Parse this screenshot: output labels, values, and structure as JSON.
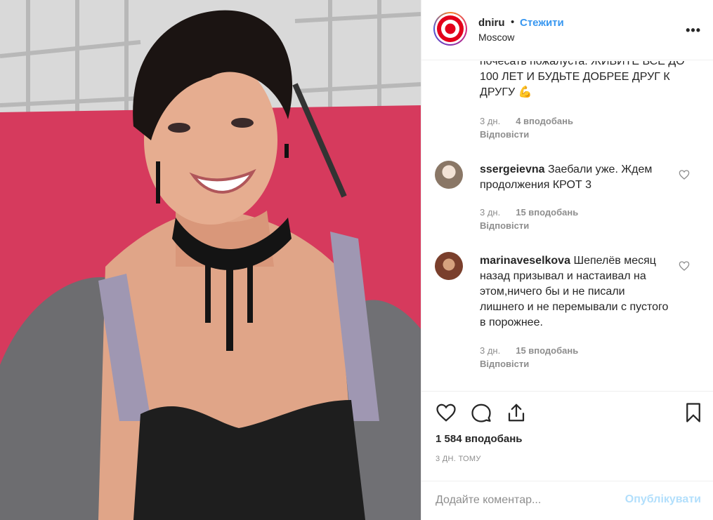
{
  "post": {
    "username": "dniru",
    "separator": "•",
    "follow_label": "Стежити",
    "location": "Moscow",
    "more_label": "•••"
  },
  "comments": [
    {
      "text": "почесать пожалуста. ЖИВИТЕ ВСЕ ДО 100 ЛЕТ И БУДЬТЕ ДОБРЕЕ ДРУГ К ДРУГУ 💪",
      "time": "3 дн.",
      "likes": "4 вподобань",
      "reply": "Відповісти"
    },
    {
      "username": "ssergeievna",
      "text": "Заебали уже. Ждем продолжения КРОТ 3",
      "time": "3 дн.",
      "likes": "15 вподобань",
      "reply": "Відповісти"
    },
    {
      "username": "marinaveselkova",
      "text": "Шепелёв месяц назад призывал и настаивал на этом,ничего бы и не писали лишнего и не перемывали с пустого в порожнее.",
      "time": "3 дн.",
      "likes": "15 вподобань",
      "reply": "Відповісти"
    }
  ],
  "actions": {
    "likes_total": "1 584 вподобань",
    "posted_ago": "3 ДН. ТОМУ"
  },
  "composer": {
    "placeholder": "Додайте коментар...",
    "publish_label": "Опублікувати"
  },
  "colors": {
    "link_blue": "#3897f0",
    "publish_disabled": "#b2dffc",
    "muted_text": "#8e8e8e",
    "logo_red": "#e3001b"
  },
  "icons": [
    "heart-icon",
    "comment-icon",
    "share-icon",
    "bookmark-icon",
    "more-icon"
  ]
}
